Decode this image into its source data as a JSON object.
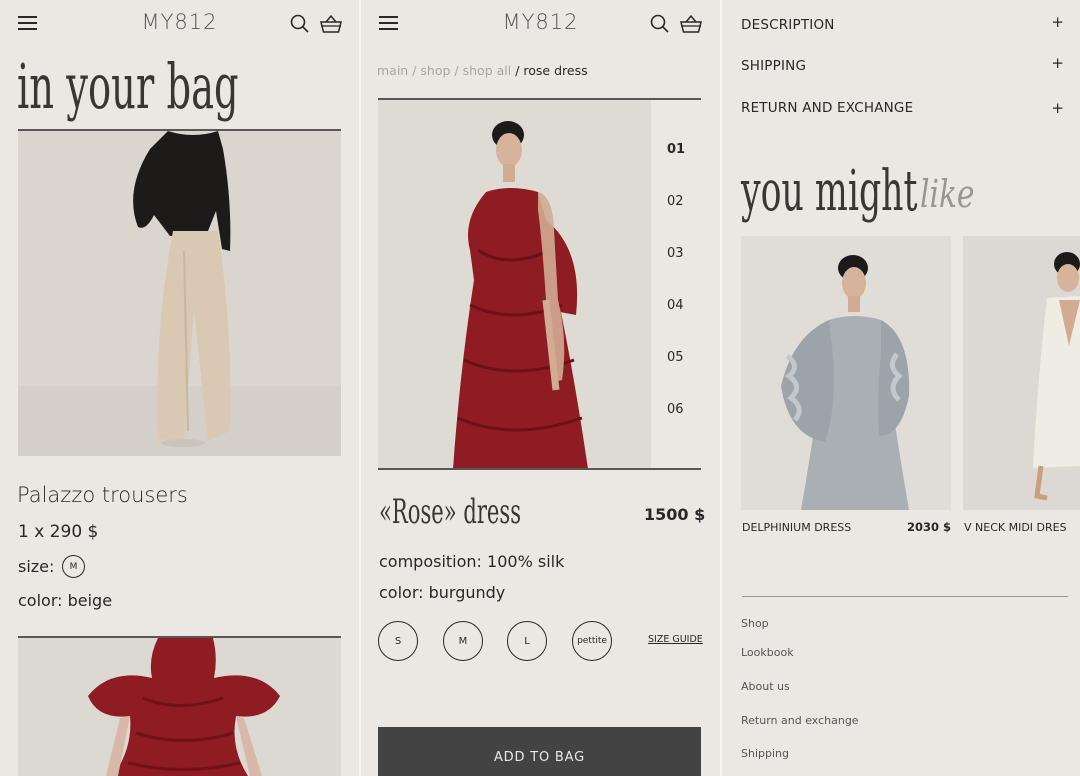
{
  "brand": "MY812",
  "bag": {
    "title": "in your bag",
    "item1": {
      "name": "Palazzo trousers",
      "qty_price": "1 x 290 $",
      "size_label": "size:",
      "size_value": "M",
      "color_label": "color: beige"
    }
  },
  "product": {
    "breadcrumb": {
      "main": "main",
      "sep1": " / ",
      "shop": "shop",
      "sep2": " / ",
      "shop_all": "shop all",
      "sep3": " / ",
      "current": "rose dress"
    },
    "thumbs": [
      "01",
      "02",
      "03",
      "04",
      "05",
      "06"
    ],
    "title": "«Rose» dress",
    "price": "1500 $",
    "composition": "composition: 100% silk",
    "color": "color: burgundy",
    "sizes": [
      "S",
      "M",
      "L",
      "pettite"
    ],
    "size_guide": "SIZE GUIDE",
    "add_to_bag": "ADD TO BAG"
  },
  "details": {
    "accordion": [
      {
        "label": "DESCRIPTION",
        "icon": "+"
      },
      {
        "label": "SHIPPING",
        "icon": "+"
      },
      {
        "label": "RETURN AND EXCHANGE",
        "icon": "+"
      }
    ],
    "recs_title_a": "you might",
    "recs_title_b": "like",
    "recs": [
      {
        "name": "DELPHINIUM DRESS",
        "price": "2030 $"
      },
      {
        "name": "V NECK MIDI DRES",
        "price": ""
      }
    ],
    "footer_links": [
      "Shop",
      "Lookbook",
      "About us",
      "Return and exchange",
      "Shipping"
    ]
  },
  "colors": {
    "background": "#ebe8e4",
    "text": "#2a2826",
    "burgundy": "#8e1c22",
    "button": "#444343"
  }
}
